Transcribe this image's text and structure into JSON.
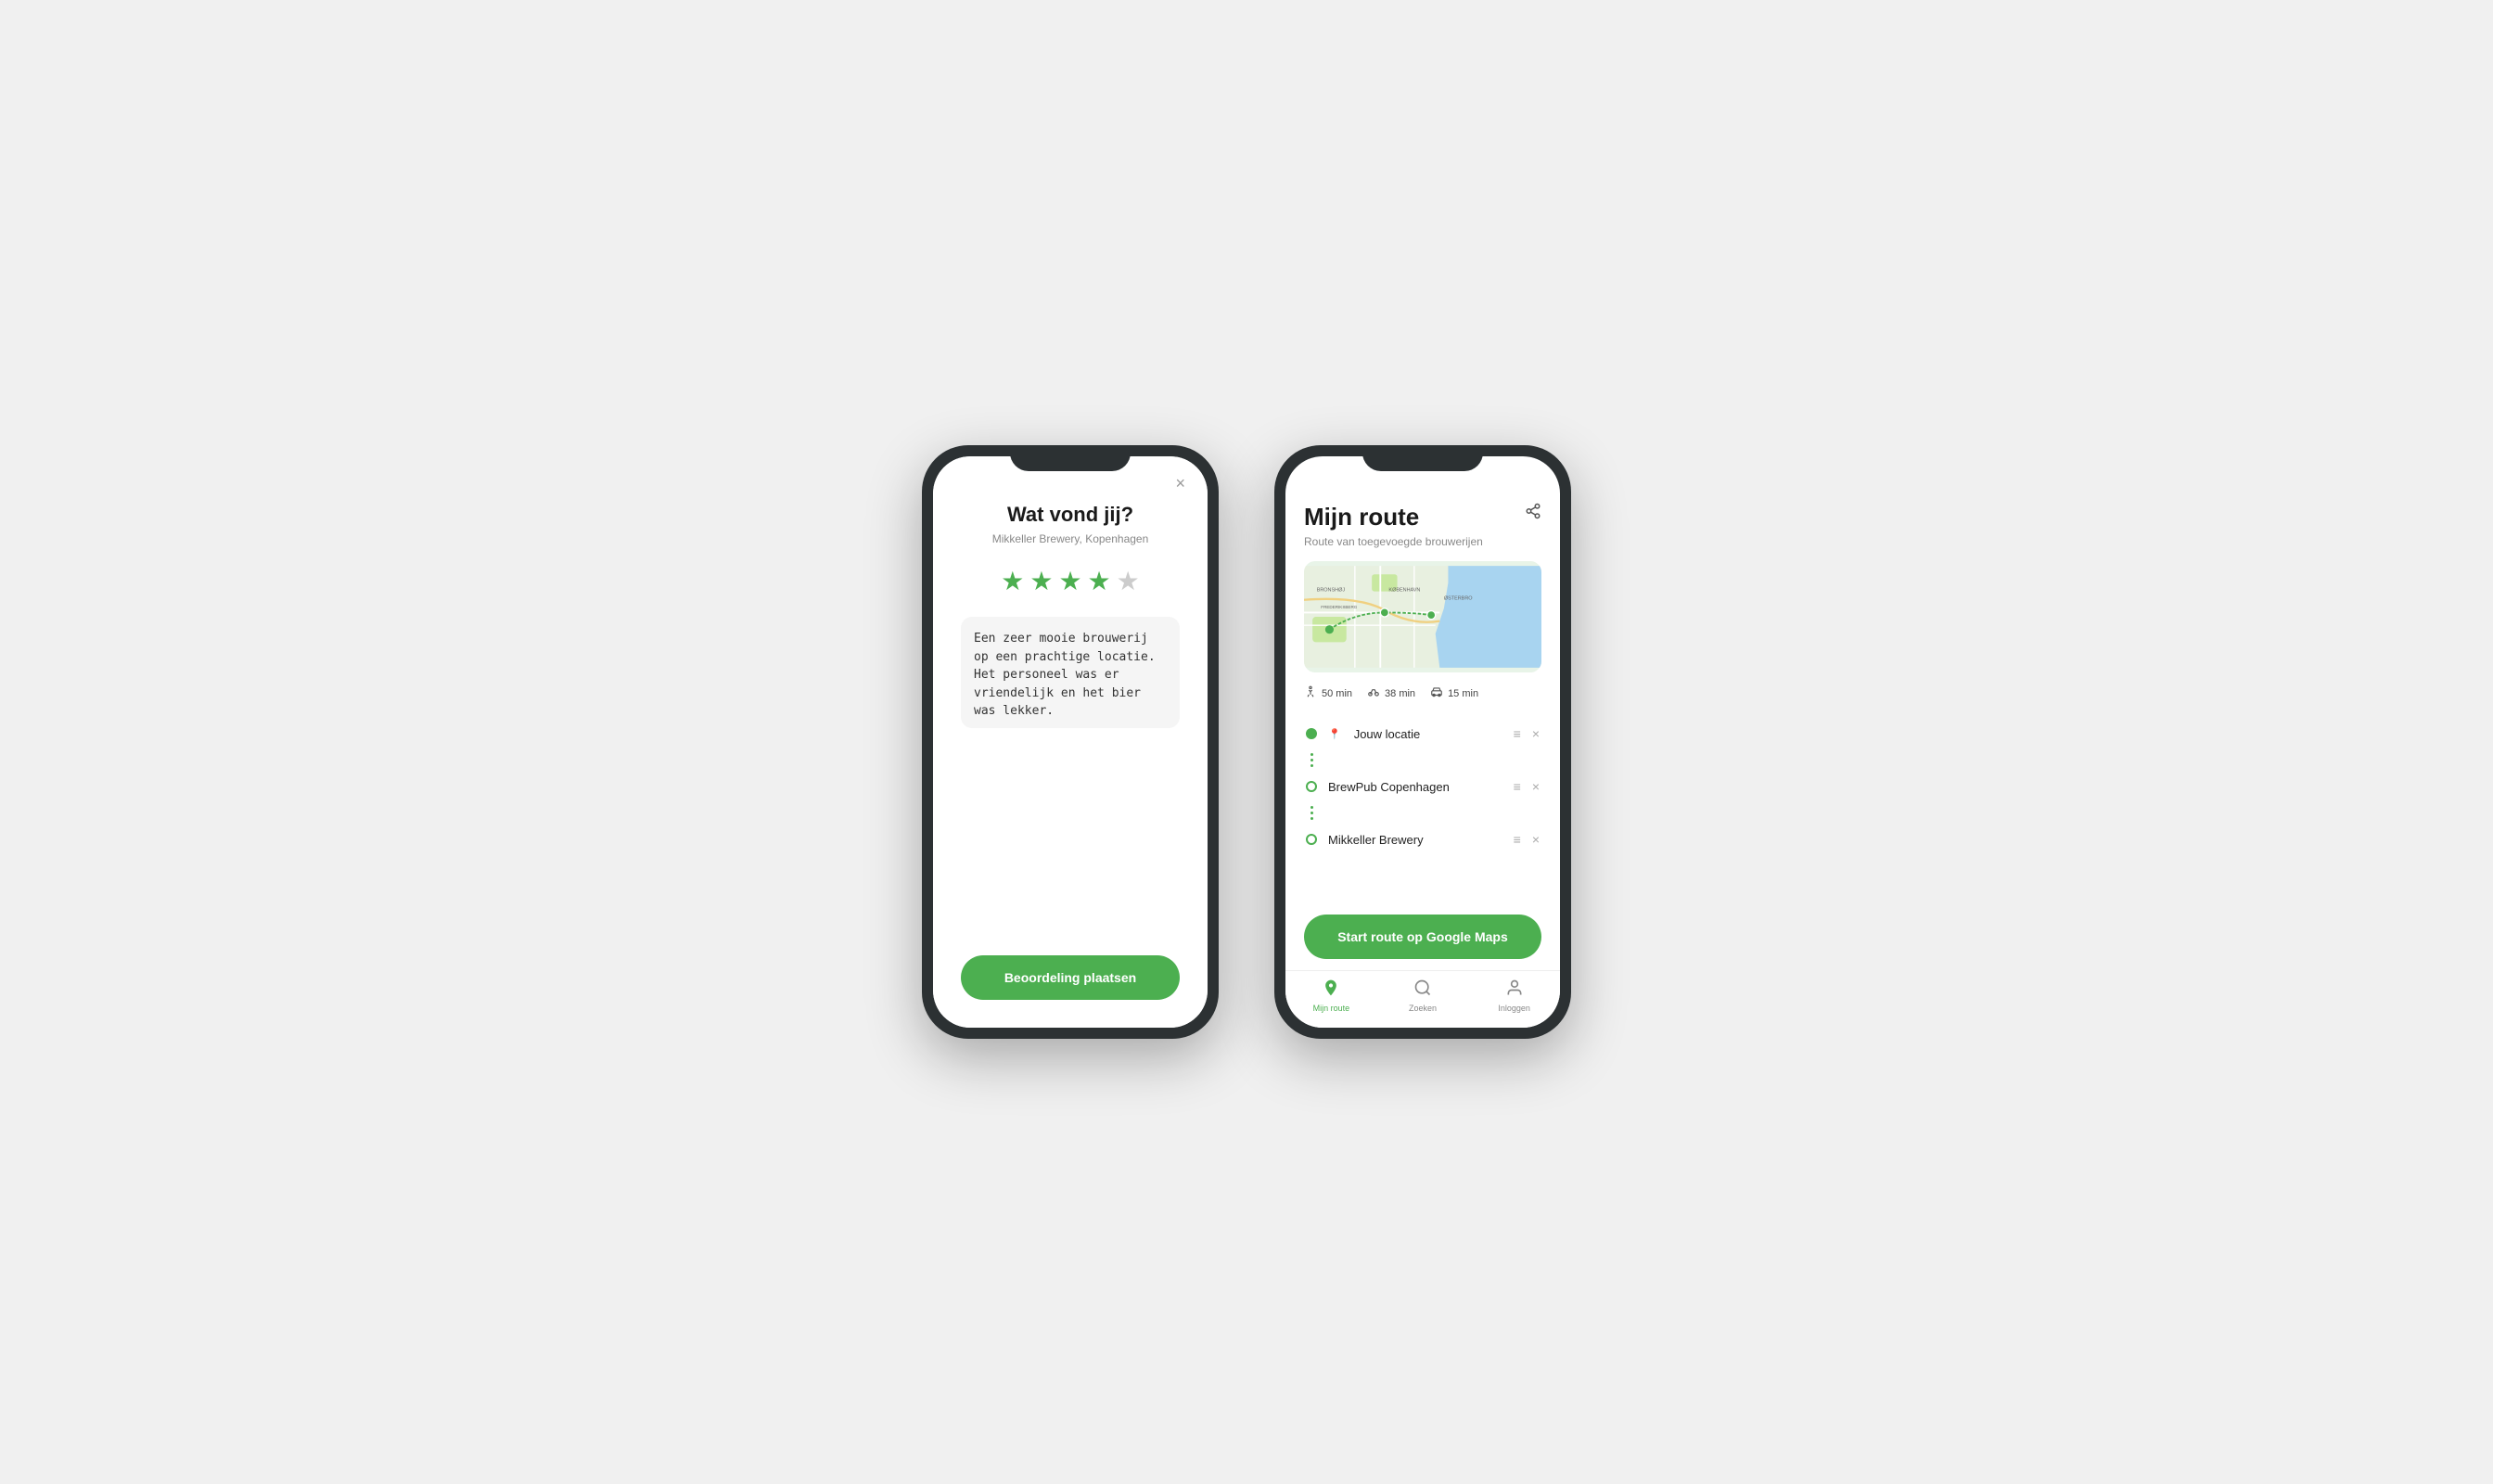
{
  "phone1": {
    "modal": {
      "title": "Wat vond jij?",
      "subtitle": "Mikkeller Brewery, Kopenhagen",
      "stars": [
        true,
        true,
        true,
        true,
        false
      ],
      "review_text": "Een zeer mooie brouwerij op een prachtige locatie. Het personeel was er vriendelijk en het bier was lekker.",
      "submit_label": "Beoordeling plaatsen",
      "close_label": "×"
    }
  },
  "phone2": {
    "header": {
      "title": "Mijn route",
      "description": "Route van toegevoegde brouwerijen",
      "share_icon": "⤢"
    },
    "travel_times": [
      {
        "icon": "🚶",
        "value": "50 min"
      },
      {
        "icon": "🚲",
        "value": "38 min"
      },
      {
        "icon": "🚗",
        "value": "15 min"
      }
    ],
    "stops": [
      {
        "id": 0,
        "type": "filled",
        "label": "Jouw locatie",
        "has_location_icon": true
      },
      {
        "id": 1,
        "type": "outline",
        "label": "BrewPub Copenhagen",
        "has_location_icon": false
      },
      {
        "id": 2,
        "type": "outline",
        "label": "Mikkeller Brewery",
        "has_location_icon": false
      }
    ],
    "start_route_label": "Start route op Google Maps",
    "nav": [
      {
        "id": "route",
        "label": "Mijn route",
        "icon": "📍",
        "active": true
      },
      {
        "id": "search",
        "label": "Zoeken",
        "icon": "🔍",
        "active": false
      },
      {
        "id": "login",
        "label": "Inloggen",
        "icon": "👤",
        "active": false
      }
    ]
  }
}
